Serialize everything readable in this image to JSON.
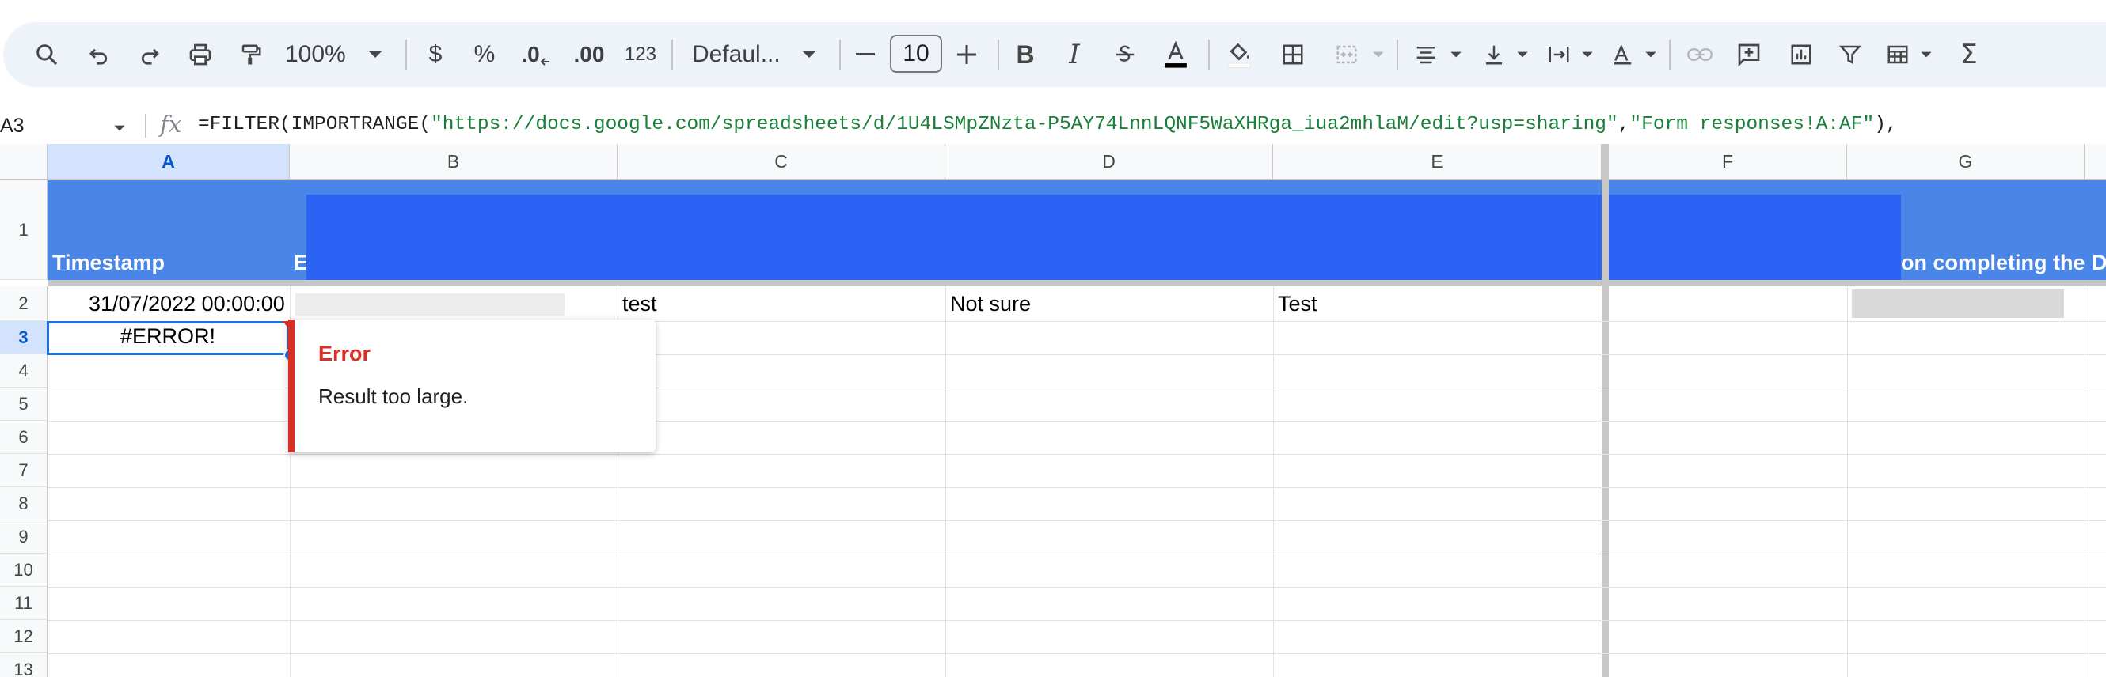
{
  "window": {
    "title_fragment": "'"
  },
  "toolbar": {
    "zoom": "100%",
    "currency": "$",
    "percent": "%",
    "decrease_decimal": ".0",
    "increase_decimal": ".00",
    "number_format": "123",
    "font_name": "Defaul...",
    "font_size": "10",
    "icons": [
      "search-icon",
      "undo-icon",
      "redo-icon",
      "print-icon",
      "paint-format-icon",
      "bold-icon",
      "italic-icon",
      "strikethrough-icon",
      "text-color-icon",
      "fill-color-icon",
      "borders-icon",
      "merge-cells-icon",
      "align-icon",
      "valign-icon",
      "text-wrap-icon",
      "text-rotation-icon",
      "link-icon",
      "comment-icon",
      "chart-icon",
      "filter-icon",
      "table-icon",
      "functions-icon"
    ]
  },
  "formula_bar": {
    "name_box": "A3",
    "fx": "fx",
    "formula_prefix": "=FILTER(IMPORTRANGE(",
    "formula_url": "\"https://docs.google.com/spreadsheets/d/1U4LSMpZNzta-P5AY74LnnLQNF5WaXHRga_iua2mhlaM/edit?usp=sharing\"",
    "formula_comma": ",",
    "formula_range": "\"Form responses!A:AF\"",
    "formula_suffix": "),"
  },
  "columns": [
    "A",
    "B",
    "C",
    "D",
    "E",
    "F",
    "G"
  ],
  "rows": [
    "1",
    "2",
    "3",
    "4",
    "5",
    "6",
    "7",
    "8",
    "9",
    "10",
    "11",
    "12",
    "13"
  ],
  "header_row": {
    "a": "Timestamp",
    "b": "E",
    "g": "on completing the",
    "h": "D"
  },
  "row2": {
    "a": "31/07/2022 00:00:00",
    "c": "test",
    "d": "Not sure",
    "e": "Test"
  },
  "row3": {
    "a": "#ERROR!"
  },
  "error": {
    "title": "Error",
    "message": "Result too large."
  },
  "colors": {
    "header_band": "#4a86e8",
    "redaction": "#2b64f4",
    "error": "#d93025",
    "selection": "#1a73e8"
  }
}
